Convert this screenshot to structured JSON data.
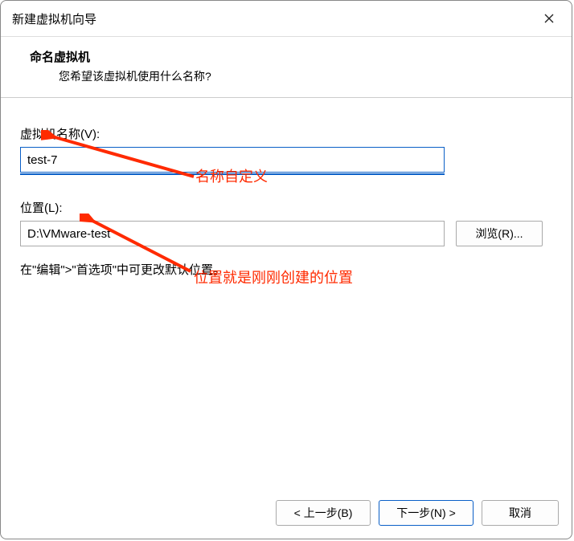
{
  "titlebar": {
    "title": "新建虚拟机向导"
  },
  "header": {
    "title": "命名虚拟机",
    "subtitle": "您希望该虚拟机使用什么名称?"
  },
  "fields": {
    "name_label": "虚拟机名称(V):",
    "name_value": "test-7",
    "location_label": "位置(L):",
    "location_value": "D:\\VMware-test",
    "browse_label": "浏览(R)..."
  },
  "hint": "在\"编辑\">\"首选项\"中可更改默认位置。",
  "annotations": {
    "name_note": "名称自定义",
    "location_note": "位置就是刚刚创建的位置"
  },
  "buttons": {
    "back": "< 上一步(B)",
    "next": "下一步(N) >",
    "cancel": "取消"
  }
}
